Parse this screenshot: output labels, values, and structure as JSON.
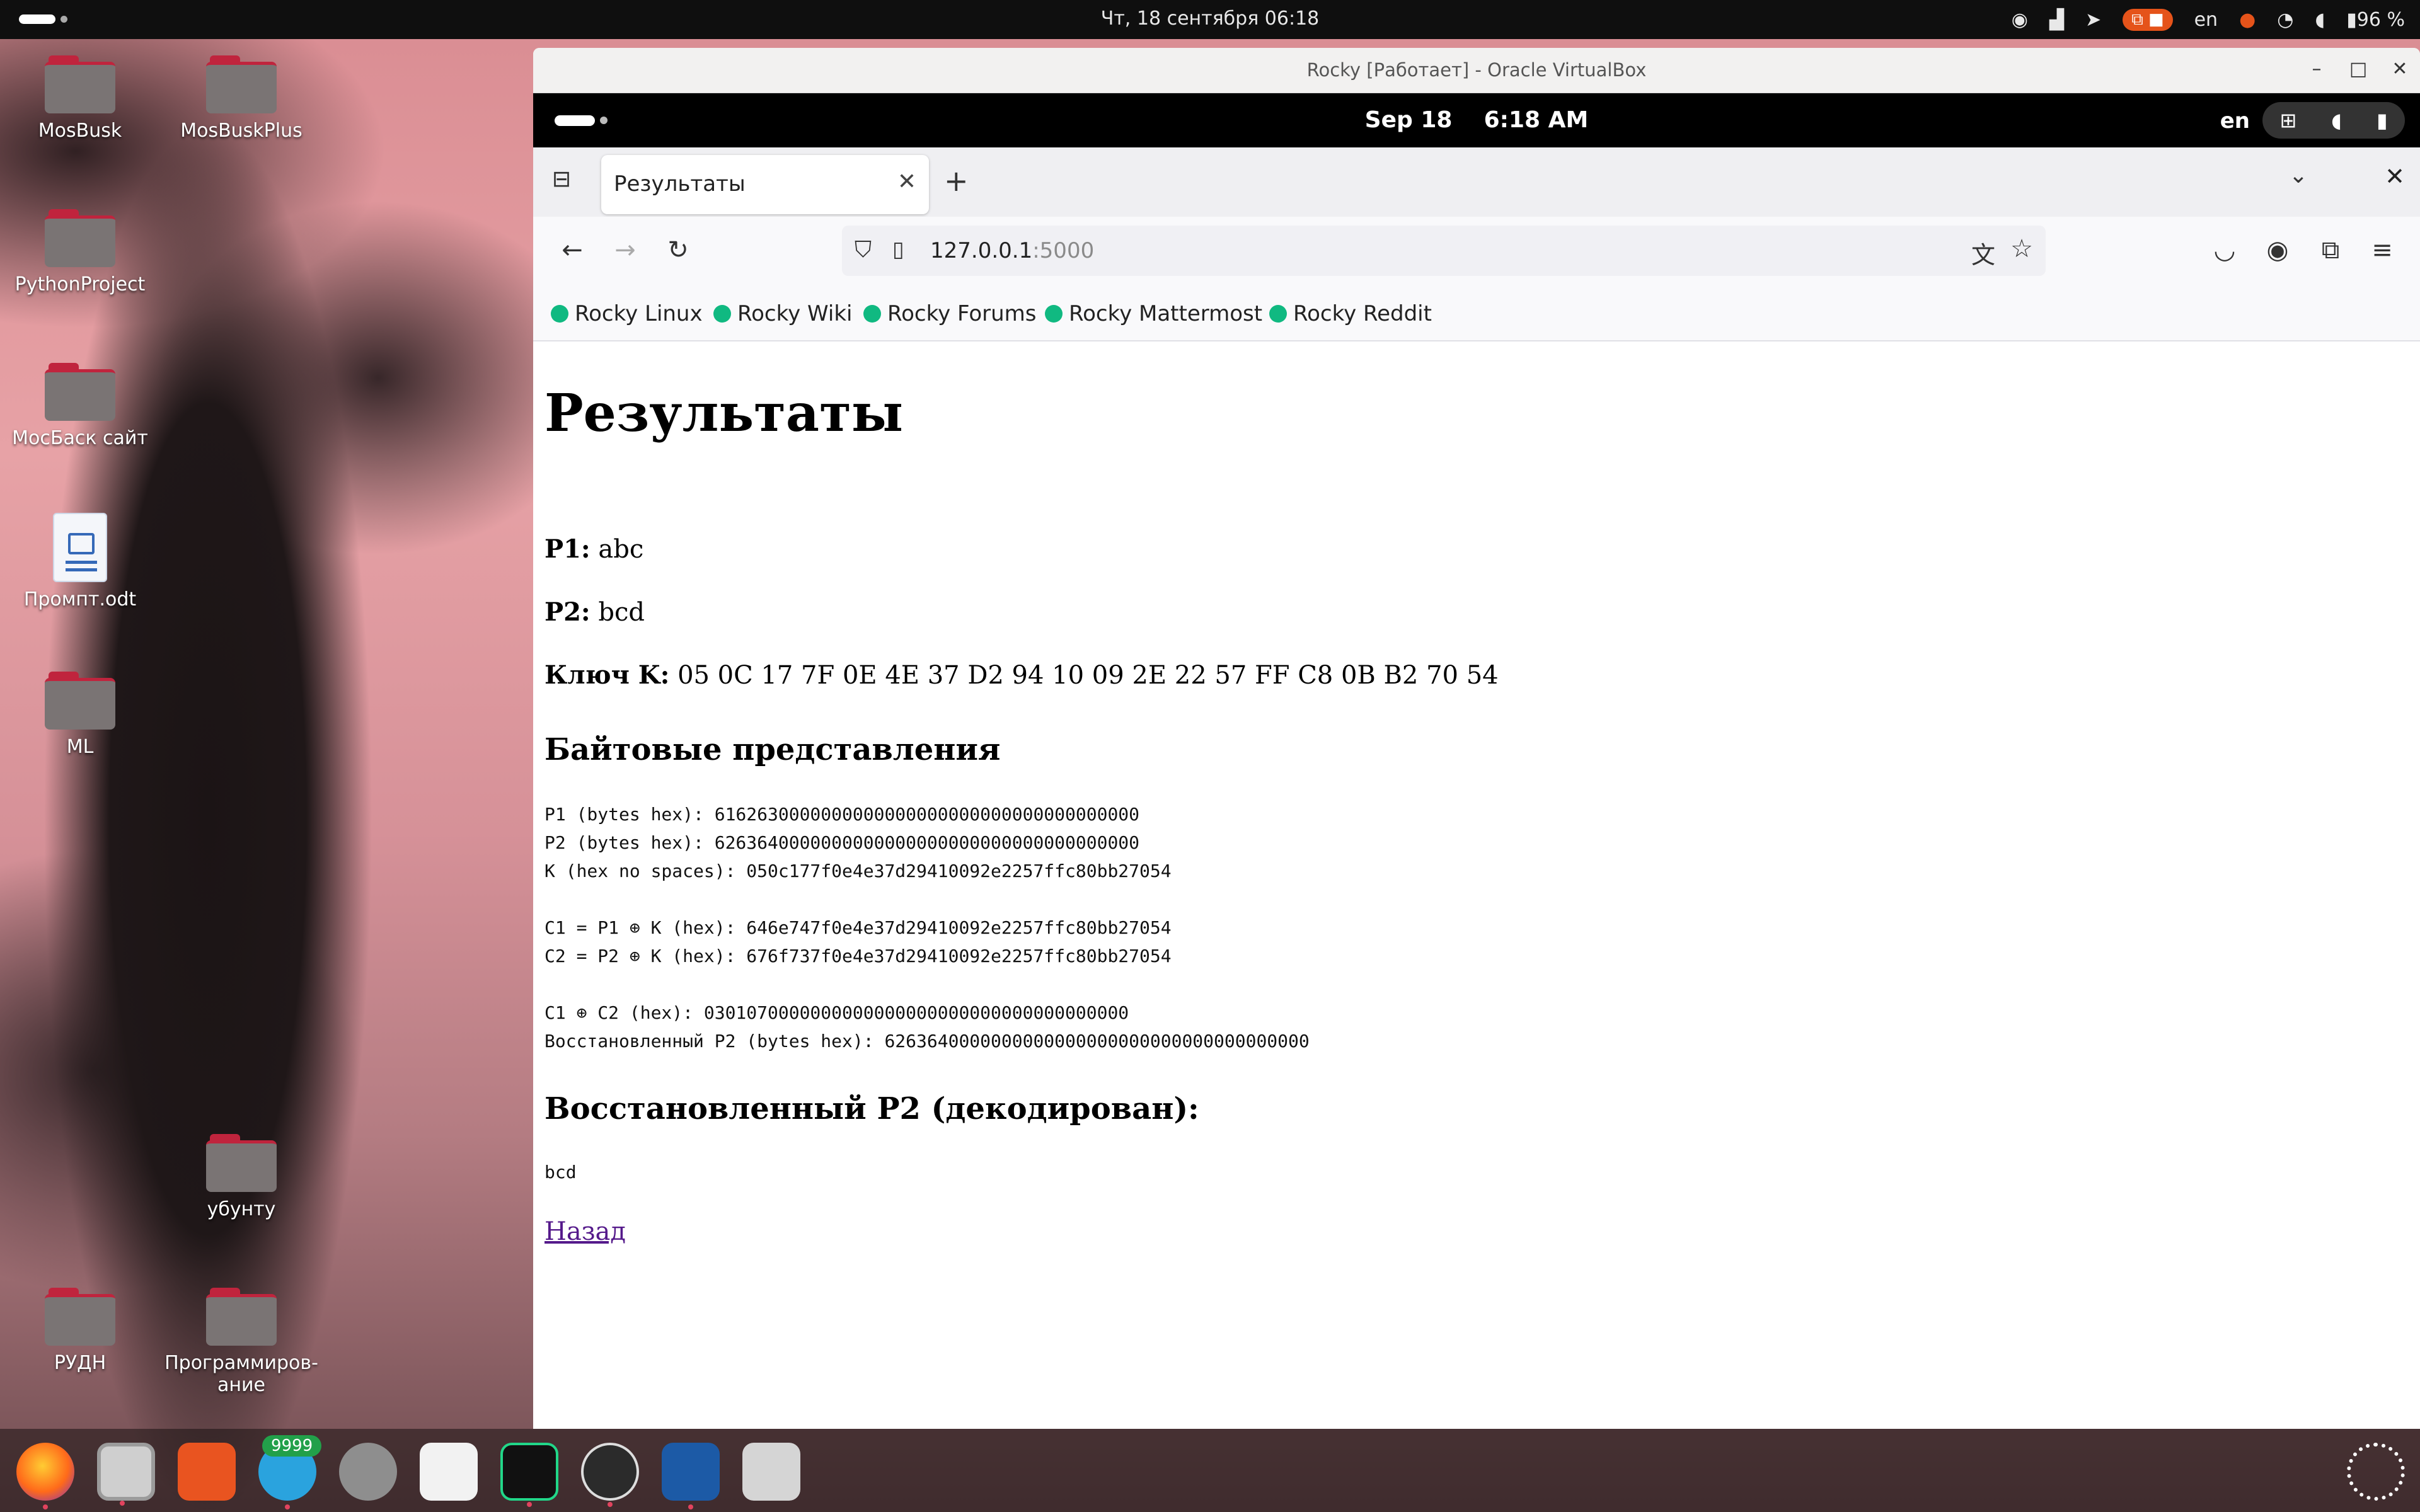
{
  "host": {
    "topbar": {
      "clock": "Чт, 18 сентября  06:18",
      "lang": "en",
      "battery": "96 %"
    },
    "desktop_icons": [
      {
        "label": "MosBusk",
        "type": "folder"
      },
      {
        "label": "MosBuskPlus",
        "type": "folder"
      },
      {
        "label": "PythonProject",
        "type": "folder"
      },
      {
        "label": "МосБаск сайт",
        "type": "folder"
      },
      {
        "label": "Промпт.odt",
        "type": "document"
      },
      {
        "label": "ML",
        "type": "folder"
      },
      {
        "label": "убунту",
        "type": "folder"
      },
      {
        "label": "РУДН",
        "type": "folder"
      },
      {
        "label": "Программиров-ание",
        "type": "folder"
      }
    ],
    "dock": {
      "telegram_badge": "9999",
      "apps": [
        "firefox-icon",
        "files-icon",
        "app-center-icon",
        "telegram-icon",
        "settings-icon",
        "system-monitor-icon",
        "pycharm-icon",
        "obs-icon",
        "virtualbox-icon",
        "trash-icon",
        "show-apps-icon"
      ]
    }
  },
  "vbox": {
    "title": "Rocky [Работает] - Oracle VirtualBox",
    "guest_topbar": {
      "date": "Sep 18",
      "time": "6:18 AM",
      "lang": "en"
    },
    "browser": {
      "tab_title": "Результаты",
      "url_host": "127.0.0.1",
      "url_port": ":5000",
      "bookmarks": [
        "Rocky Linux",
        "Rocky Wiki",
        "Rocky Forums",
        "Rocky Mattermost",
        "Rocky Reddit"
      ]
    },
    "page": {
      "heading": "Результаты",
      "p1_label": "P1:",
      "p1_value": "abc",
      "p2_label": "P2:",
      "p2_value": "bcd",
      "key_label": "Ключ K:",
      "key_value": "05 0C 17 7F 0E 4E 37 D2 94 10 09 2E 22 57 FF C8 0B B2 70 54",
      "bytes_heading": "Байтовые представления",
      "bytes_block": "P1 (bytes hex): 6162630000000000000000000000000000000000\nP2 (bytes hex): 6263640000000000000000000000000000000000\nK (hex no spaces): 050c177f0e4e37d29410092e2257ffc80bb27054\n\nC1 = P1 ⊕ K (hex): 646e747f0e4e37d29410092e2257ffc80bb27054\nC2 = P2 ⊕ K (hex): 676f737f0e4e37d29410092e2257ffc80bb27054\n\nC1 ⊕ C2 (hex): 0301070000000000000000000000000000000000\nВосстановленный P2 (bytes hex): 6263640000000000000000000000000000000000",
      "recovered_heading": "Восстановленный P2 (декодирован):",
      "recovered_value": "bcd",
      "back_link": "Назад"
    }
  }
}
